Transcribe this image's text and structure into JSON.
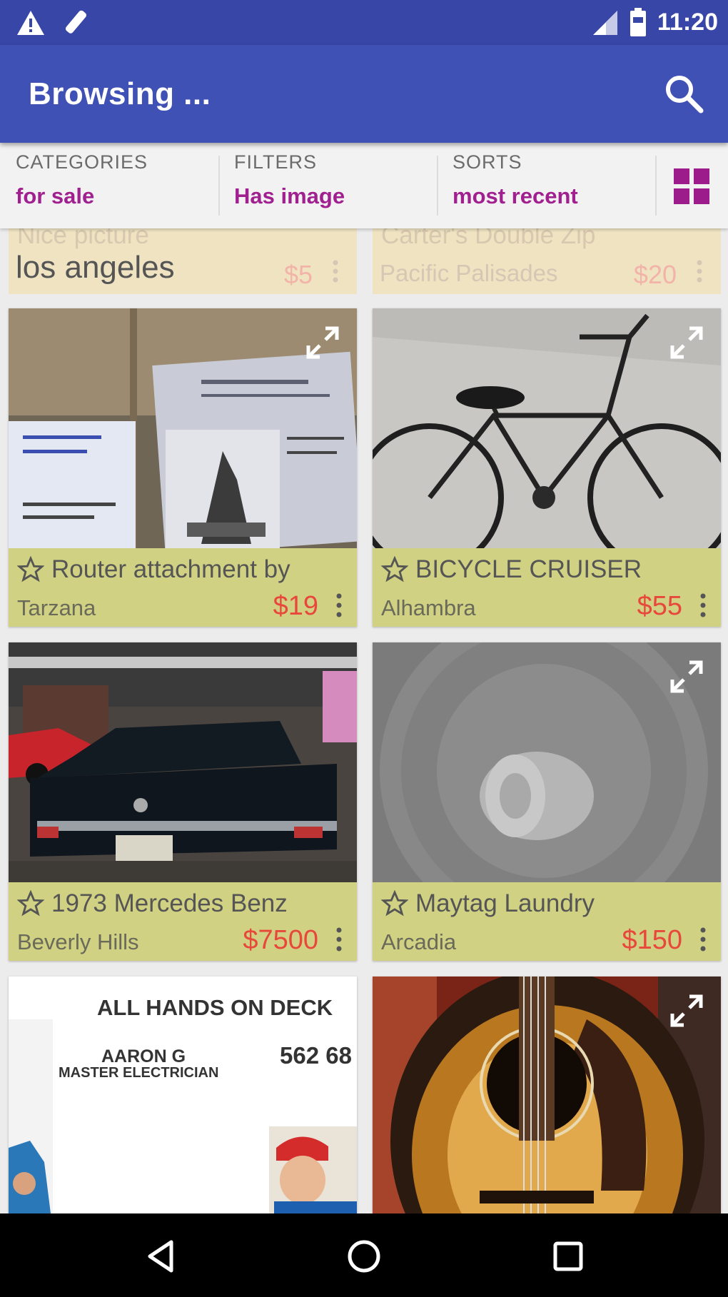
{
  "status_bar": {
    "time": "11:20",
    "icons": [
      "warning-icon",
      "edit-icon",
      "signal-icon",
      "battery-icon"
    ]
  },
  "app_bar": {
    "title": "Browsing ...",
    "search_icon": "search-icon"
  },
  "filter_bar": {
    "categories": {
      "label": "CATEGORIES",
      "value": "for sale"
    },
    "filters": {
      "label": "FILTERS",
      "value": "Has image"
    },
    "sorts": {
      "label": "SORTS",
      "value": "most recent"
    },
    "view_icon": "grid-view-icon"
  },
  "partial_row": [
    {
      "title": "Nice picture",
      "location": "los angeles",
      "price": "$5"
    },
    {
      "title": "Carter's Double Zip",
      "location": "Pacific Palisades",
      "price": "$20"
    }
  ],
  "listings": [
    {
      "title": "Router attachment by",
      "location": "Tarzana",
      "price": "$19",
      "image": "router-attachment-photo"
    },
    {
      "title": "BICYCLE CRUISER",
      "location": "Alhambra",
      "price": "$55",
      "image": "bicycle-photo"
    },
    {
      "title": "1973 Mercedes Benz",
      "location": "Beverly Hills",
      "price": "$7500",
      "image": "mercedes-photo"
    },
    {
      "title": "Maytag Laundry",
      "location": "Arcadia",
      "price": "$150",
      "image": "washer-drum-photo"
    }
  ],
  "bottom_row": [
    {
      "image": "electrician-ad",
      "headline": "ALL HANDS ON DECK",
      "name": "AARON G",
      "subtitle": "MASTER ELECTRICIAN",
      "phone": "562 68"
    },
    {
      "image": "guitar-photo"
    }
  ],
  "colors": {
    "status_bar": "#3846a8",
    "app_bar": "#3f51b5",
    "accent": "#a1208f",
    "price": "#e8473b",
    "caption_bg": "#cdcd78"
  },
  "nav_bar": {
    "icons": [
      "back-icon",
      "home-icon",
      "recents-icon"
    ]
  }
}
